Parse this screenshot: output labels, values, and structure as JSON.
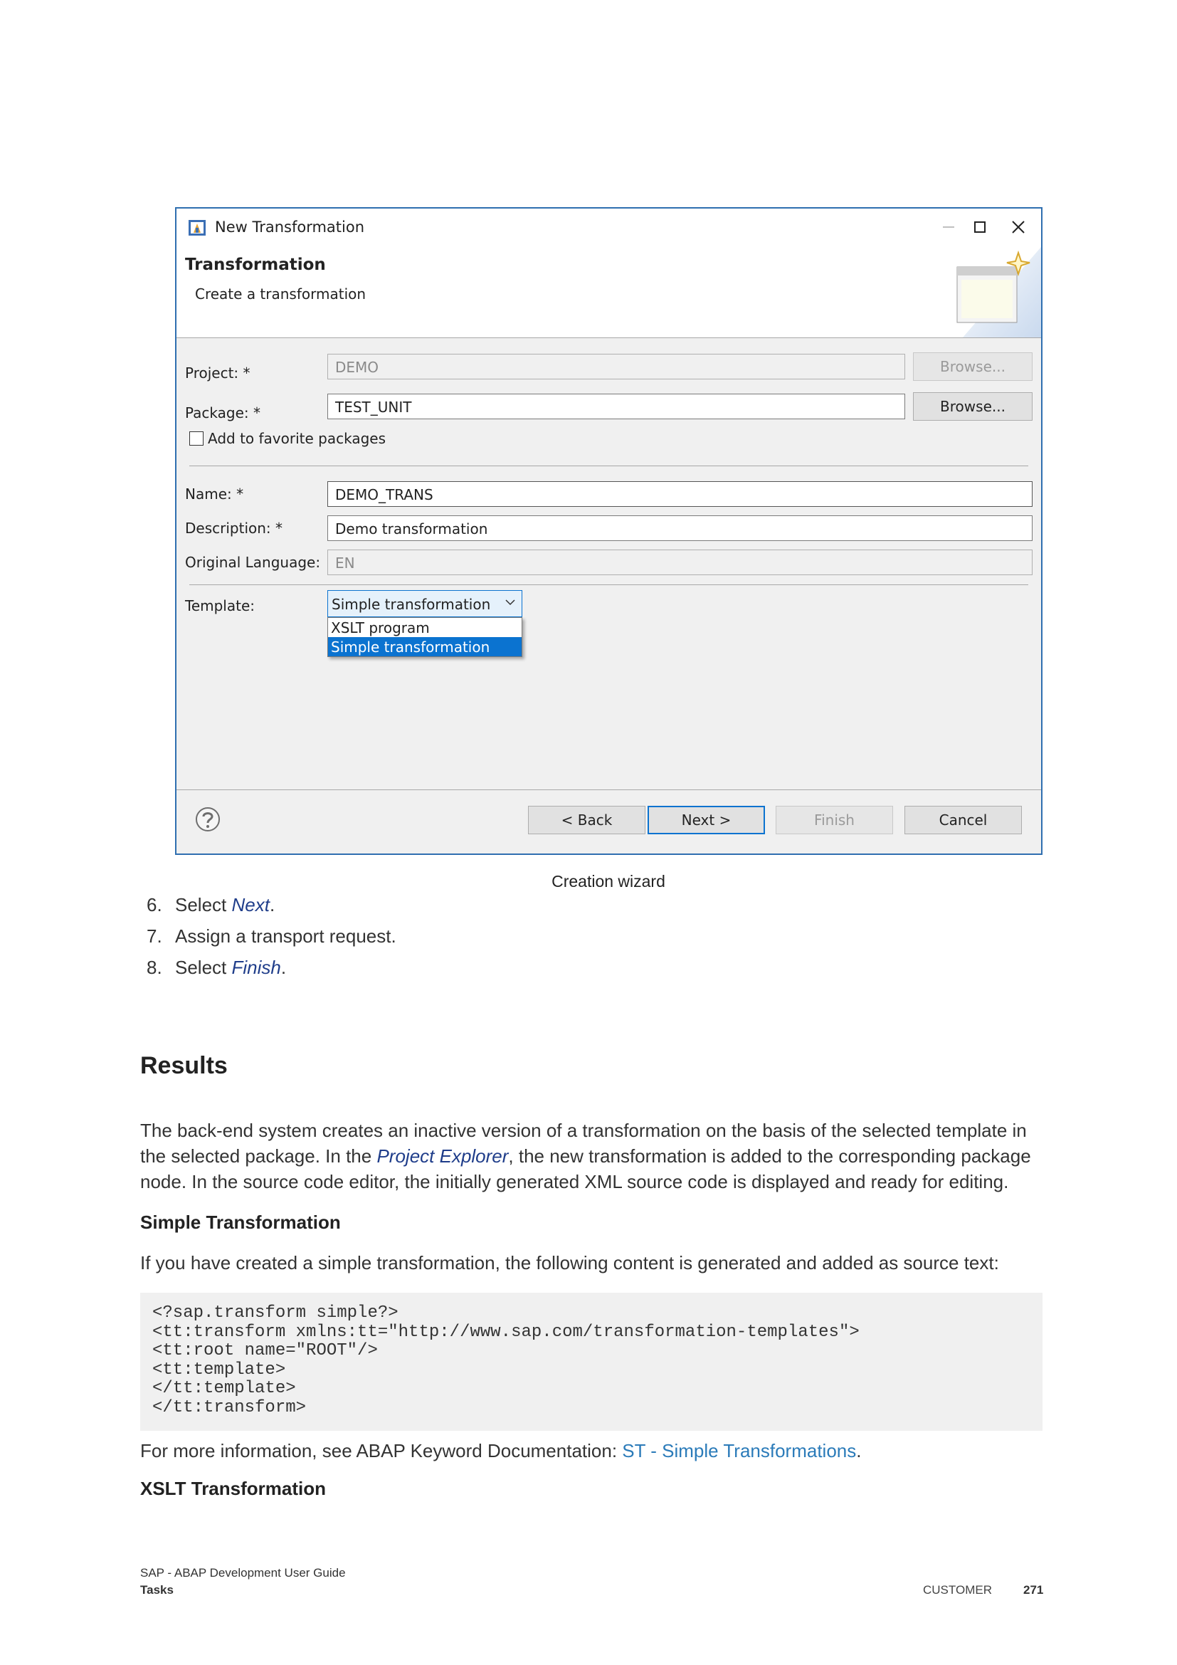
{
  "dialog": {
    "title": "New Transformation",
    "header_title": "Transformation",
    "header_subtitle": "Create a transformation",
    "project_label": "Project: *",
    "project_value": "DEMO",
    "package_label": "Package: *",
    "package_value": "TEST_UNIT",
    "browse_label": "Browse...",
    "favorite_label": "Add to favorite packages",
    "name_label": "Name: *",
    "name_value": "DEMO_TRANS",
    "description_label": "Description: *",
    "description_value": "Demo transformation",
    "language_label": "Original Language:",
    "language_value": "EN",
    "template_label": "Template:",
    "template_value": "Simple transformation",
    "template_options": [
      "XSLT program",
      "Simple transformation"
    ],
    "back_label": "< Back",
    "next_label": "Next >",
    "finish_label": "Finish",
    "cancel_label": "Cancel"
  },
  "caption": "Creation wizard",
  "steps": [
    {
      "num": "6.",
      "pre": "Select ",
      "link": "Next",
      "post": "."
    },
    {
      "num": "7.",
      "pre": "Assign a transport request.",
      "link": "",
      "post": ""
    },
    {
      "num": "8.",
      "pre": "Select ",
      "link": "Finish",
      "post": "."
    }
  ],
  "results": {
    "heading": "Results",
    "para_1a": "The back-end system creates an inactive version of a transformation on the basis of the selected template in the selected package. In the ",
    "para_1_link": "Project Explorer",
    "para_1b": ", the new transformation is added to the corresponding package node. In the source code editor, the initially generated XML source code is displayed and ready for editing.",
    "simple_heading": "Simple Transformation",
    "simple_para": "If you have created a simple transformation, the following content is generated and added as source text:",
    "code": "<?sap.transform simple?>\n<tt:transform xmlns:tt=\"http://www.sap.com/transformation-templates\">\n<tt:root name=\"ROOT\"/>\n<tt:template>\n</tt:template>\n</tt:transform>",
    "more_info_pre": "For more information, see ABAP Keyword Documentation: ",
    "more_info_link": "ST - Simple Transformations",
    "more_info_post": ".",
    "xslt_heading": "XSLT Transformation"
  },
  "footer": {
    "guide_title": "SAP - ABAP Development User Guide",
    "section": "Tasks",
    "classification": "CUSTOMER",
    "page_number": "271"
  },
  "colors": {
    "accent": "#0b73d0",
    "link": "#2b7bb9",
    "ui_link": "#1f3d8a"
  }
}
